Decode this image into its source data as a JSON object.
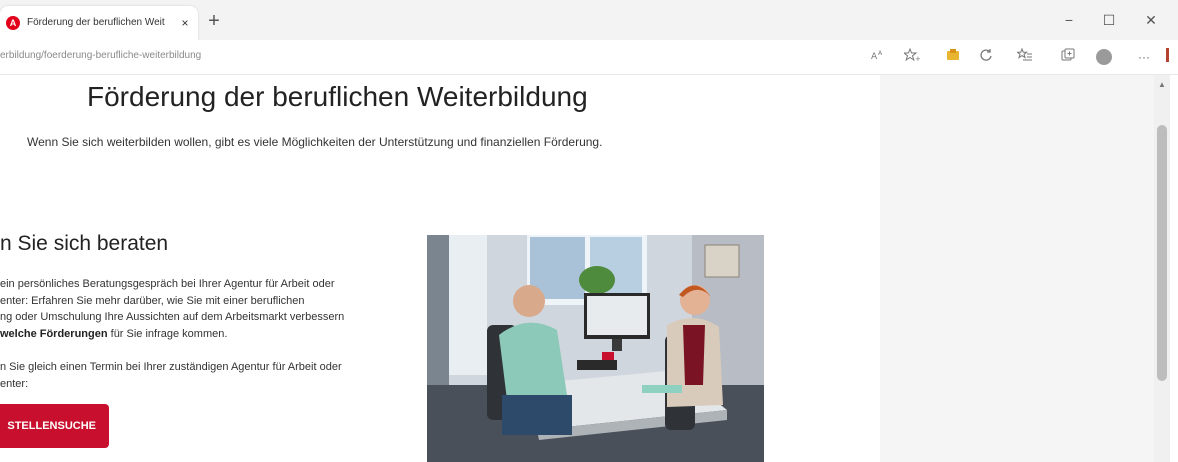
{
  "browser": {
    "tab_title": "Förderung der beruflichen Weit",
    "tab_close": "×",
    "new_tab": "+",
    "window_controls": {
      "minimize": "−",
      "maximize": "☐",
      "close": "✕"
    },
    "url": "erbildung/foerderung-berufliche-weiterbildung",
    "toolbar_icons": [
      "read-aloud-icon",
      "favorite-add-icon",
      "extension-icon",
      "refresh-icon",
      "favorites-icon",
      "collections-icon",
      "profile-icon",
      "more-icon"
    ],
    "more_label": "···",
    "accent": "#b3432f"
  },
  "page": {
    "title": "Förderung der beruflichen Weiterbildung",
    "intro": "Wenn Sie sich weiterbilden wollen, gibt es viele Möglichkeiten der Unterstützung und finanziellen Förderung.",
    "section_heading": "n Sie sich beraten",
    "para1": {
      "line1": "ein persönliches Beratungsgespräch bei Ihrer Agentur für Arbeit oder",
      "line2": "enter: Erfahren Sie mehr darüber, wie Sie mit einer beruflichen",
      "line3": "ng oder Umschulung Ihre Aussichten auf dem Arbeitsmarkt verbessern",
      "line4_bold": "welche Förderungen",
      "line4_rest": " für Sie infrage kommen."
    },
    "para2": {
      "line1": "n Sie gleich einen Termin bei Ihrer zuständigen Agentur für Arbeit oder",
      "line2": "enter:"
    },
    "cta_label": "STELLENSUCHE",
    "cta_color": "#c8102e",
    "photo_label": "consultation-photo"
  }
}
